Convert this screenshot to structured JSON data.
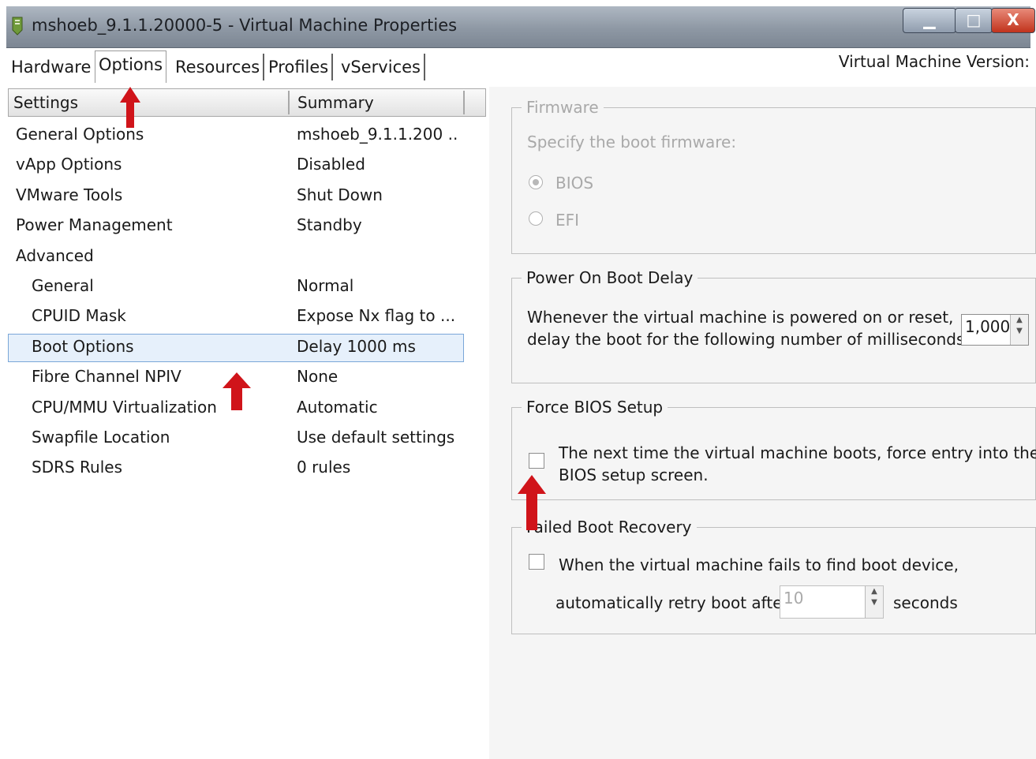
{
  "window": {
    "title": "mshoeb_9.1.1.20000-5 - Virtual Machine Properties",
    "minimize_glyph": "▁",
    "maximize_glyph": "□",
    "close_glyph": "X"
  },
  "tabs": [
    {
      "label": "Hardware",
      "active": false
    },
    {
      "label": "Options",
      "active": true
    },
    {
      "label": "Resources",
      "active": false
    },
    {
      "label": "Profiles",
      "active": false
    },
    {
      "label": "vServices",
      "active": false
    }
  ],
  "vm_version_label": "Virtual Machine Version:",
  "list": {
    "columns": [
      "Settings",
      "Summary"
    ],
    "rows": [
      {
        "setting": "General Options",
        "summary": "mshoeb_9.1.1.200 ..",
        "indent": false
      },
      {
        "setting": "vApp Options",
        "summary": "Disabled",
        "indent": false
      },
      {
        "setting": "VMware Tools",
        "summary": "Shut Down",
        "indent": false
      },
      {
        "setting": "Power Management",
        "summary": "Standby",
        "indent": false
      },
      {
        "setting": "Advanced",
        "summary": "",
        "indent": false
      },
      {
        "setting": "General",
        "summary": "Normal",
        "indent": true
      },
      {
        "setting": "CPUID Mask",
        "summary": "Expose Nx flag to ...",
        "indent": true
      },
      {
        "setting": "Boot Options",
        "summary": "Delay 1000 ms",
        "indent": true,
        "selected": true
      },
      {
        "setting": "Fibre Channel NPIV",
        "summary": "None",
        "indent": true
      },
      {
        "setting": "CPU/MMU Virtualization",
        "summary": "Automatic",
        "indent": true
      },
      {
        "setting": "Swapfile Location",
        "summary": "Use default settings",
        "indent": true
      },
      {
        "setting": "SDRS Rules",
        "summary": "0 rules",
        "indent": true
      }
    ]
  },
  "firmware": {
    "legend": "Firmware",
    "prompt": "Specify the boot firmware:",
    "options": [
      "BIOS",
      "EFI"
    ],
    "selected": "BIOS",
    "enabled": false
  },
  "power_on_boot_delay": {
    "legend": "Power On Boot Delay",
    "line1": "Whenever the virtual machine is powered on or reset,",
    "line2": "delay the boot for the following number of milliseconds:",
    "value": "1,000"
  },
  "force_bios_setup": {
    "legend": "Force BIOS Setup",
    "line1": "The next time the virtual machine boots, force entry into the",
    "line2": "BIOS setup screen.",
    "checked": false
  },
  "failed_boot_recovery": {
    "legend": "Failed Boot Recovery",
    "line1": "When the virtual machine fails to find boot device,",
    "line2": "automatically retry boot after",
    "value": "10",
    "unit": "seconds",
    "checked": false
  },
  "colors": {
    "annotation_arrow": "#d0141a",
    "selection_border": "#7aa7d8",
    "title_bar": "#8e98a4"
  }
}
